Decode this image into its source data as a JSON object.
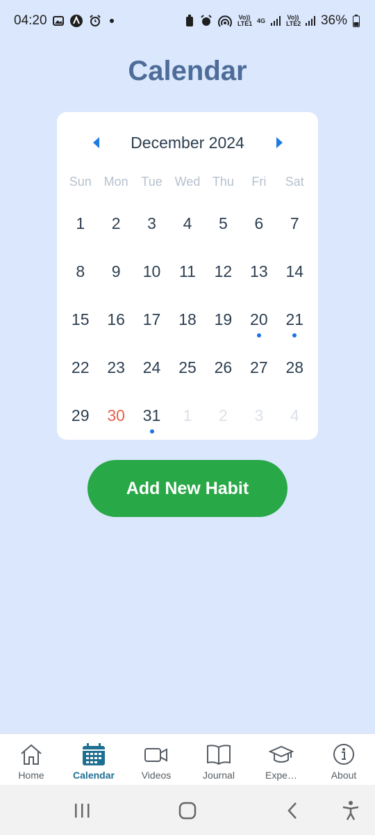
{
  "status_bar": {
    "time": "04:20",
    "network_vo_lte1": "Vo)) LTE1",
    "network_4g": "4G",
    "network_vo_lte2": "Vo)) LTE2",
    "battery": "36%"
  },
  "page": {
    "title": "Calendar"
  },
  "calendar": {
    "month_label": "December 2024",
    "weekdays": [
      "Sun",
      "Mon",
      "Tue",
      "Wed",
      "Thu",
      "Fri",
      "Sat"
    ],
    "days": [
      {
        "label": "1"
      },
      {
        "label": "2"
      },
      {
        "label": "3"
      },
      {
        "label": "4"
      },
      {
        "label": "5"
      },
      {
        "label": "6"
      },
      {
        "label": "7"
      },
      {
        "label": "8"
      },
      {
        "label": "9"
      },
      {
        "label": "10"
      },
      {
        "label": "11"
      },
      {
        "label": "12"
      },
      {
        "label": "13"
      },
      {
        "label": "14"
      },
      {
        "label": "15"
      },
      {
        "label": "16"
      },
      {
        "label": "17"
      },
      {
        "label": "18"
      },
      {
        "label": "19"
      },
      {
        "label": "20",
        "marked": true
      },
      {
        "label": "21",
        "marked": true
      },
      {
        "label": "22"
      },
      {
        "label": "23"
      },
      {
        "label": "24"
      },
      {
        "label": "25"
      },
      {
        "label": "26"
      },
      {
        "label": "27"
      },
      {
        "label": "28"
      },
      {
        "label": "29"
      },
      {
        "label": "30",
        "today": true
      },
      {
        "label": "31",
        "marked": true
      },
      {
        "label": "1",
        "muted": true
      },
      {
        "label": "2",
        "muted": true
      },
      {
        "label": "3",
        "muted": true
      },
      {
        "label": "4",
        "muted": true
      }
    ],
    "colors": {
      "today": "#e75f4a",
      "marker_dot": "#1a73e8",
      "arrow": "#1e7be2"
    }
  },
  "actions": {
    "add_habit_label": "Add New Habit",
    "add_habit_color": "#29a847"
  },
  "bottom_nav": {
    "items": [
      {
        "label": "Home",
        "icon": "home-icon"
      },
      {
        "label": "Calendar",
        "icon": "calendar-icon",
        "active": true
      },
      {
        "label": "Videos",
        "icon": "video-icon"
      },
      {
        "label": "Journal",
        "icon": "book-icon"
      },
      {
        "label": "Expe…",
        "icon": "graduation-cap-icon"
      },
      {
        "label": "About",
        "icon": "info-icon"
      }
    ],
    "active_color": "#1f6f92"
  }
}
